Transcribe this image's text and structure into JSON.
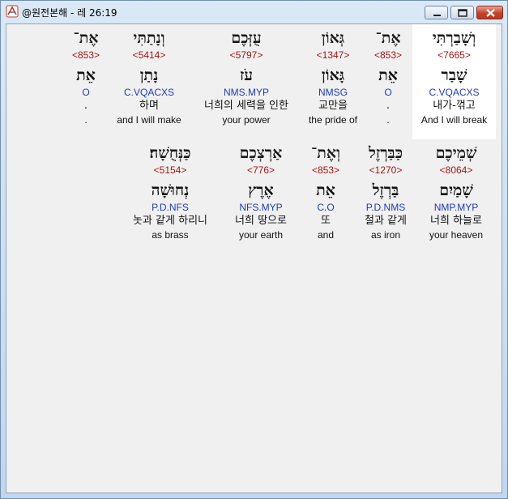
{
  "window": {
    "title": "@원전본해 - 레 26:19"
  },
  "row1": [
    {
      "hebrew": "וְשָׁבַרְתִּי",
      "strong": "<7665>",
      "lemma": "שָׁבַר",
      "morph": "C.VQACXS",
      "korean": "내가-꺾고",
      "english": "And I will break"
    },
    {
      "hebrew": "אֶת־",
      "strong": "<853>",
      "lemma": "אֵת",
      "morph": "O",
      "korean": ".",
      "english": "."
    },
    {
      "hebrew": "גְּאוֹן",
      "strong": "<1347>",
      "lemma": "גָּאוֹן",
      "morph": "NMSG",
      "korean": "교만을",
      "english": "the pride of"
    },
    {
      "hebrew": "עֻזְּכֶם",
      "strong": "<5797>",
      "lemma": "עֹז",
      "morph": "NMS.MYP",
      "korean": "너희의 세력을 인한",
      "english": "your power"
    },
    {
      "hebrew": "וְנָתַתִּי",
      "strong": "<5414>",
      "lemma": "נָתַן",
      "morph": "C.VQACXS",
      "korean": "하며",
      "english": "and I will make"
    },
    {
      "hebrew": "אֶת־",
      "strong": "<853>",
      "lemma": "אֵת",
      "morph": "O",
      "korean": ".",
      "english": "."
    }
  ],
  "row2": [
    {
      "hebrew": "שְׁמֵיכֶם",
      "strong": "<8064>",
      "lemma": "שָׁמַיִם",
      "morph": "NMP.MYP",
      "korean": "너희 하늘로",
      "english": "your heaven"
    },
    {
      "hebrew": "כַּבַּרְזֶל",
      "strong": "<1270>",
      "lemma": "בַּרְזֶל",
      "morph": "P.D.NMS",
      "korean": "철과 같게",
      "english": "as iron"
    },
    {
      "hebrew": "וְאֶת־",
      "strong": "<853>",
      "lemma": "אֵת",
      "morph": "C.O",
      "korean": "또",
      "english": "and"
    },
    {
      "hebrew": "אַרְצְכֶם",
      "strong": "<776>",
      "lemma": "אֶרֶץ",
      "morph": "NFS.MYP",
      "korean": "너희 땅으로",
      "english": "your earth"
    },
    {
      "hebrew": "כַּנְּחֻשָׁה׃",
      "strong": "<5154>",
      "lemma": "נְחוּשָׁה",
      "morph": "P.D.NFS",
      "korean": "놋과 같게 하리니",
      "english": "as brass"
    }
  ]
}
